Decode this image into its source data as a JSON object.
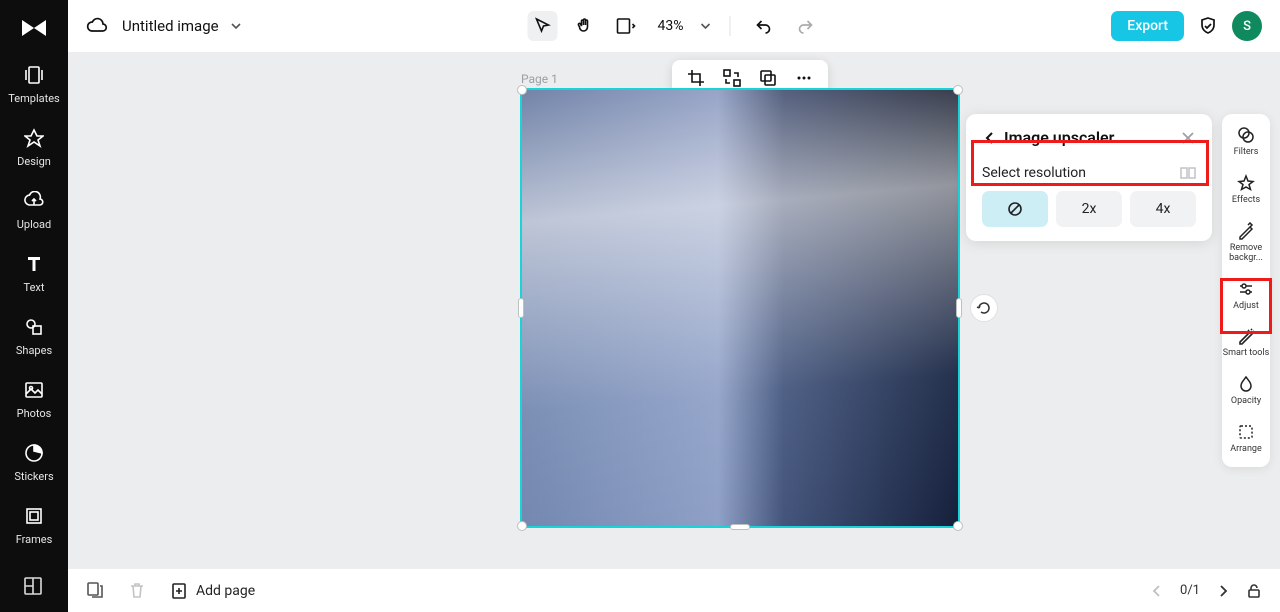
{
  "header": {
    "doc_title": "Untitled image",
    "zoom": "43%",
    "export_label": "Export",
    "avatar_initial": "S"
  },
  "left_nav": {
    "items": [
      {
        "label": "Templates"
      },
      {
        "label": "Design"
      },
      {
        "label": "Upload"
      },
      {
        "label": "Text"
      },
      {
        "label": "Shapes"
      },
      {
        "label": "Photos"
      },
      {
        "label": "Stickers"
      },
      {
        "label": "Frames"
      }
    ]
  },
  "canvas": {
    "page_label": "Page 1"
  },
  "upscaler": {
    "title": "Image upscaler",
    "select_label": "Select resolution",
    "options": {
      "none": "⊘",
      "two": "2x",
      "four": "4x"
    }
  },
  "right_rail": {
    "filters": "Filters",
    "effects": "Effects",
    "remove_bg": "Remove backgr...",
    "adjust": "Adjust",
    "smart_tools": "Smart tools",
    "opacity": "Opacity",
    "arrange": "Arrange"
  },
  "bottom": {
    "add_page": "Add page",
    "page_counter": "0/1"
  }
}
